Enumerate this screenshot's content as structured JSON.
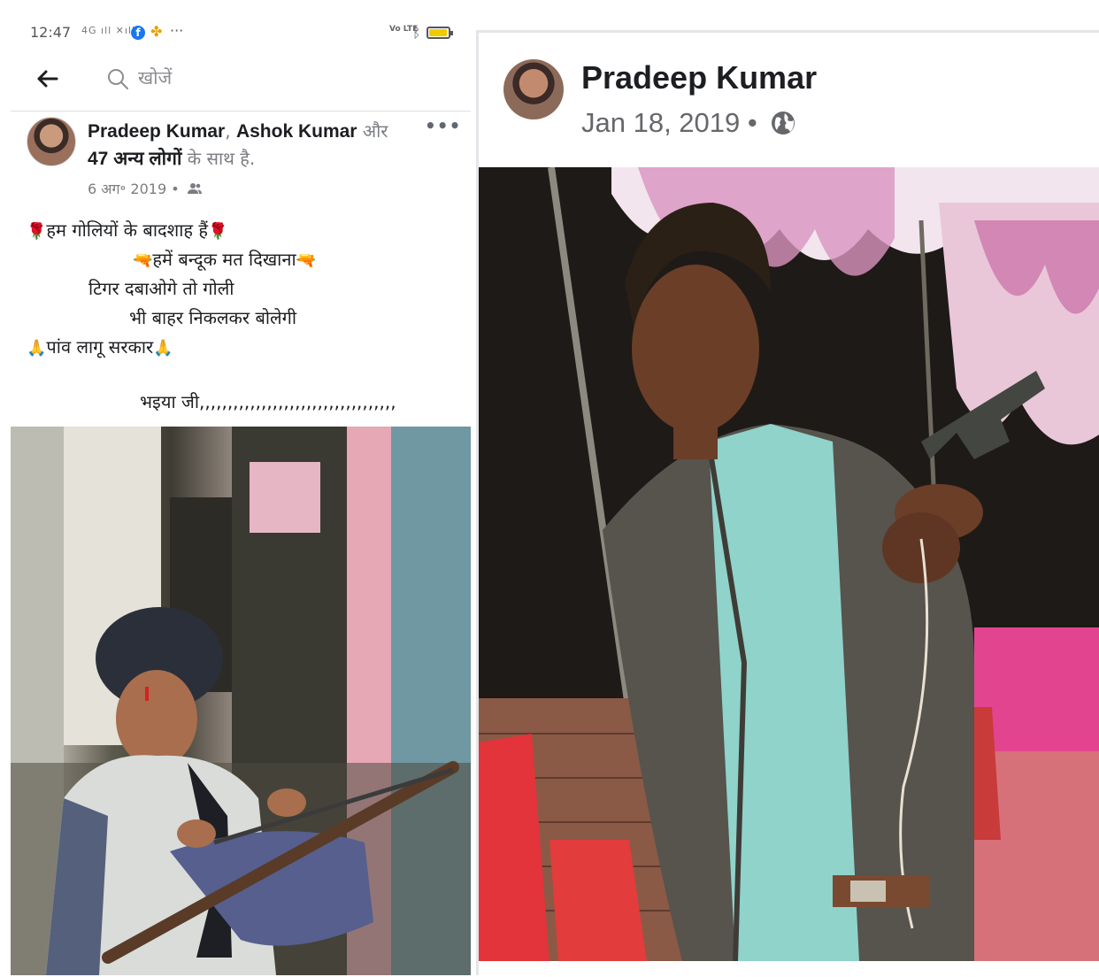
{
  "statusbar": {
    "time": "12:47",
    "signal": "4G ıll ✕ıll",
    "more": "···",
    "volte": "Vo LTE"
  },
  "search": {
    "placeholder": "खोजें"
  },
  "post_left": {
    "author1": "Pradeep Kumar",
    "comma": ",",
    "author2": "Ashok Kumar",
    "and": " और",
    "others": "47 अन्य लोगों",
    "with_text": " के साथ है.",
    "date": "6 अग॰ 2019 •",
    "lines": [
      "हम गोलियों के बादशाह हैं",
      "हमें बन्दूक मत दिखाना",
      "टिगर दबाओगे तो गोली",
      "भी बाहर निकलकर बोलेगी",
      "पांव लागू सरकार"
    ],
    "closing": "भइया जी,,,,,,,,,,,,,,,,,,,,,,,,,,,,,,,,,,,",
    "emoji": {
      "rose": "🌹",
      "gun": "🔫",
      "pray": "🙏"
    }
  },
  "post_right": {
    "name": "Pradeep Kumar",
    "date": "Jan 18, 2019 •"
  },
  "colors": {
    "facebook_blue": "#1877f2",
    "text_primary": "#1c1e21",
    "text_secondary": "#65676b"
  },
  "icons": [
    "back-arrow-icon",
    "search-icon",
    "more-dots-icon",
    "friends-icon",
    "globe-icon"
  ]
}
